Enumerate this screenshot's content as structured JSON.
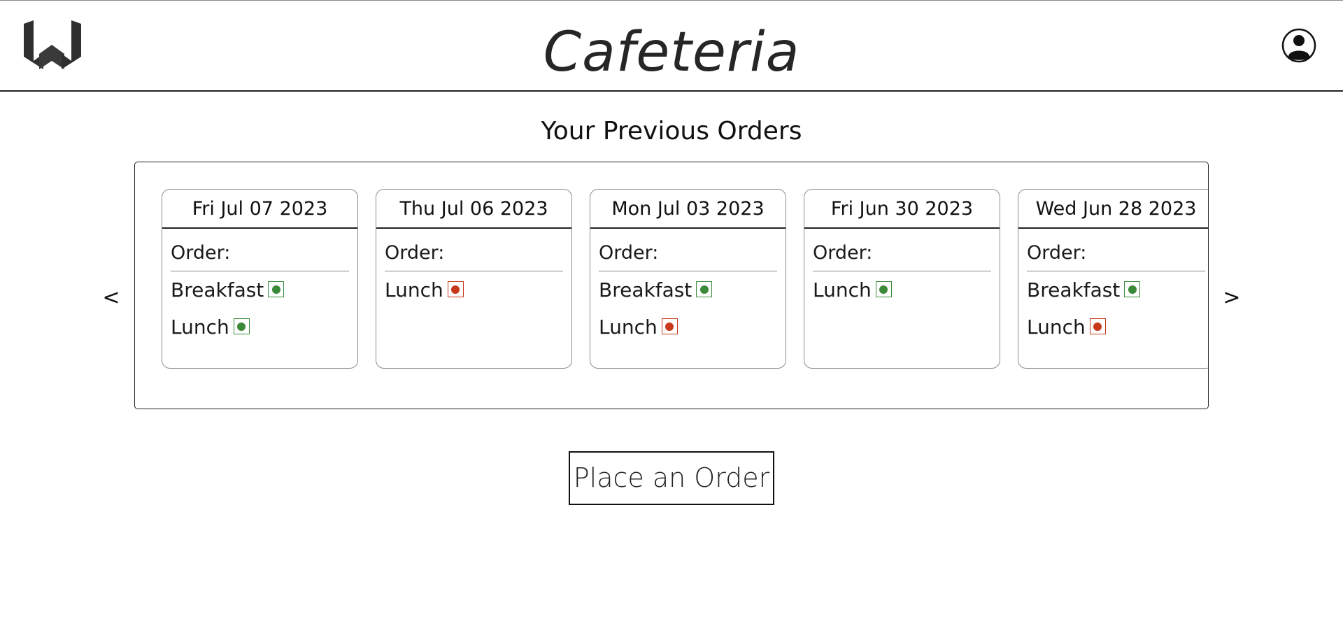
{
  "header": {
    "title": "Cafeteria",
    "logo_icon": "w-logo-icon",
    "profile_icon": "user-profile-icon"
  },
  "section_title": "Your Previous Orders",
  "carousel": {
    "prev_label": "<",
    "next_label": ">",
    "order_label": "Order:",
    "orders": [
      {
        "date": "Fri Jul 07 2023",
        "meals": [
          {
            "name": "Breakfast",
            "status": "green"
          },
          {
            "name": "Lunch",
            "status": "green"
          }
        ]
      },
      {
        "date": "Thu Jul 06 2023",
        "meals": [
          {
            "name": "Lunch",
            "status": "red"
          }
        ]
      },
      {
        "date": "Mon Jul 03 2023",
        "meals": [
          {
            "name": "Breakfast",
            "status": "green"
          },
          {
            "name": "Lunch",
            "status": "red"
          }
        ]
      },
      {
        "date": "Fri Jun 30 2023",
        "meals": [
          {
            "name": "Lunch",
            "status": "green"
          }
        ]
      },
      {
        "date": "Wed Jun 28 2023",
        "meals": [
          {
            "name": "Breakfast",
            "status": "green"
          },
          {
            "name": "Lunch",
            "status": "red"
          }
        ]
      }
    ]
  },
  "colors": {
    "green": "#3a8a3a",
    "red": "#c8381b"
  },
  "actions": {
    "place_order_label": "Place an Order"
  }
}
